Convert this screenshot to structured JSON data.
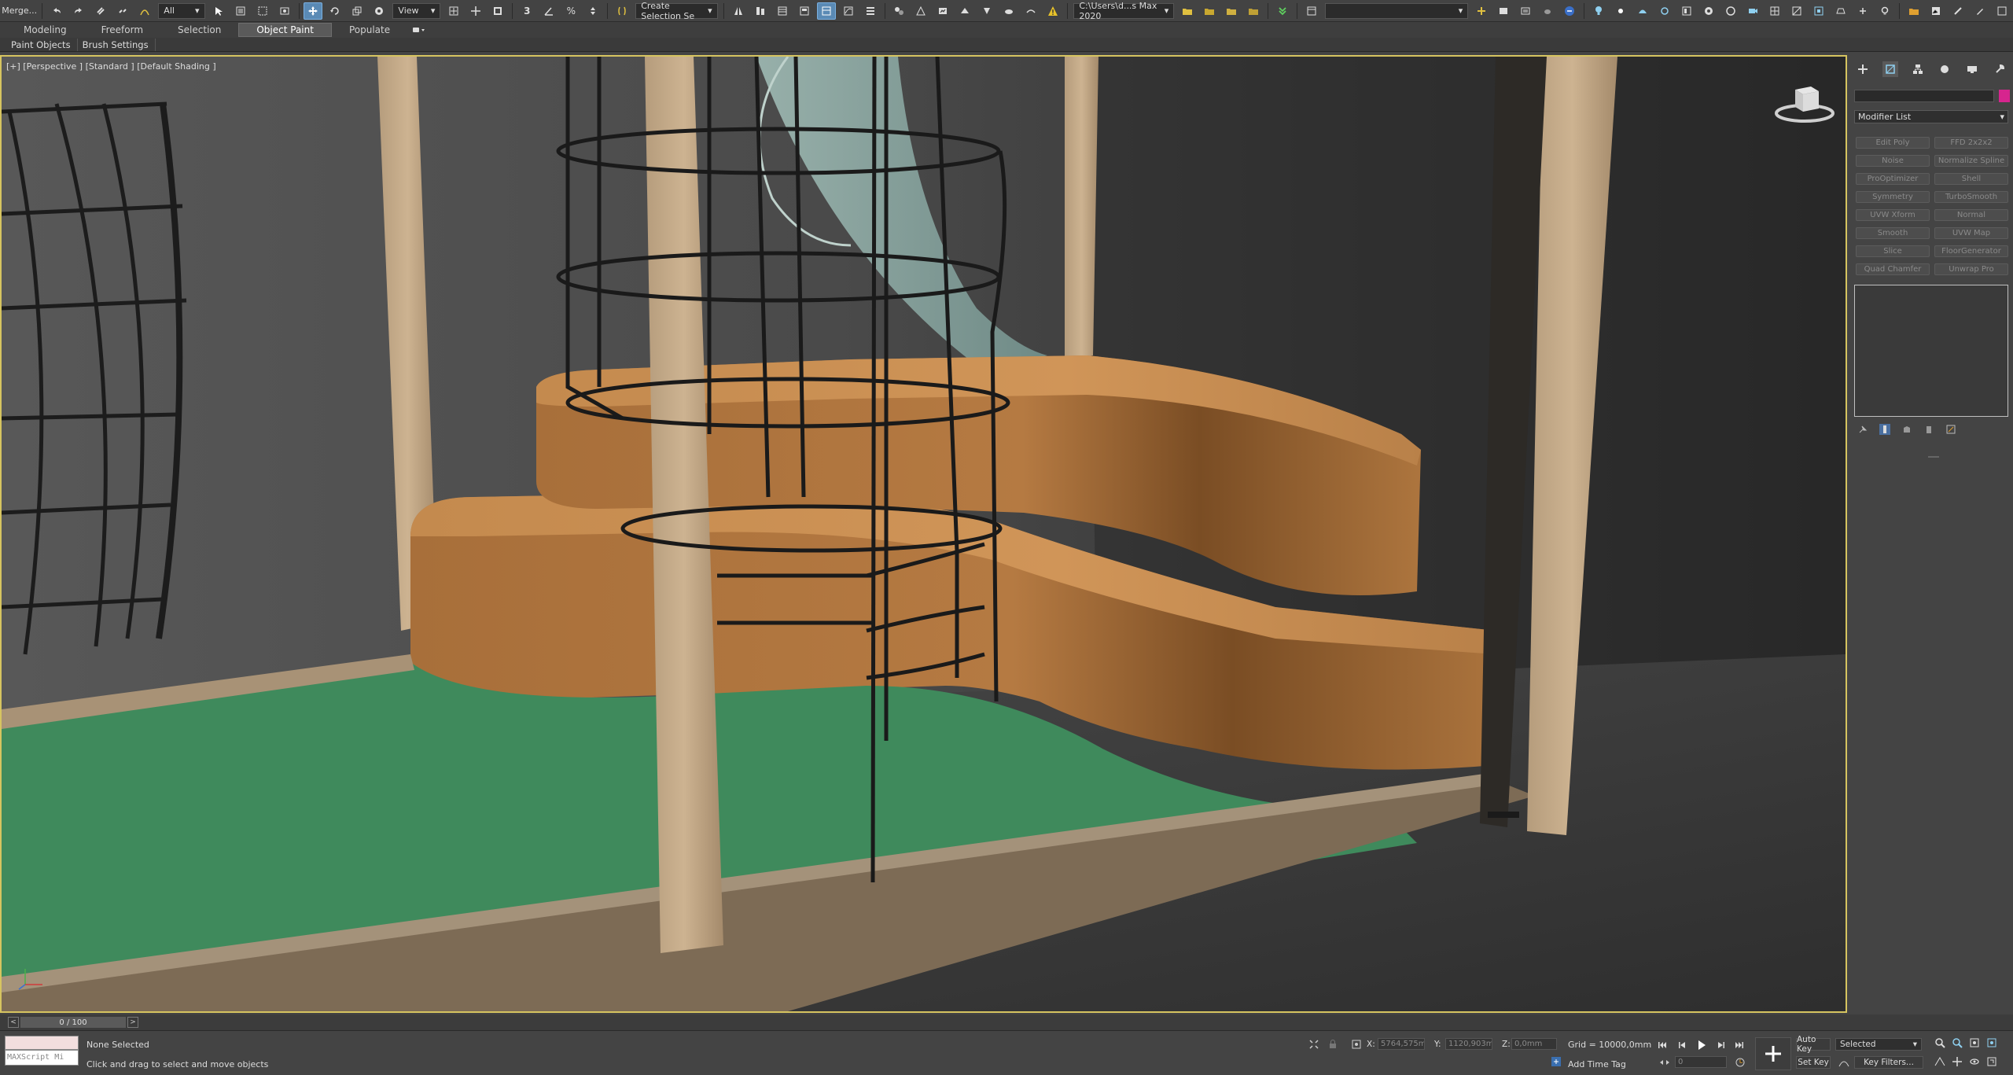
{
  "toolbar": {
    "merge_label": "Merge...",
    "filter_value": "All",
    "ref_coord_value": "View",
    "named_selection_placeholder": "Create Selection Se",
    "project_path": "C:\\Users\\d...s Max 2020"
  },
  "ribbon": {
    "tabs": [
      "Modeling",
      "Freeform",
      "Selection",
      "Object Paint",
      "Populate"
    ],
    "active_tab": "Object Paint",
    "sub_panels": [
      "Paint Objects",
      "Brush Settings"
    ]
  },
  "viewport": {
    "label": "[+] [Perspective ] [Standard ] [Default Shading ]"
  },
  "command_panel": {
    "modifier_list_label": "Modifier List",
    "modifier_buttons": [
      "Edit Poly",
      "FFD 2x2x2",
      "Noise",
      "Normalize Spline",
      "ProOptimizer",
      "Shell",
      "Symmetry",
      "TurboSmooth",
      "UVW Xform",
      "Normal",
      "Smooth",
      "UVW Map",
      "Slice",
      "FloorGenerator",
      "Quad Chamfer",
      "Unwrap Pro"
    ],
    "object_color": "#d6258e"
  },
  "timeline": {
    "frame_display": "0 / 100",
    "prev_label": "<",
    "next_label": ">"
  },
  "status": {
    "maxscript_text": "MAXScript Mi",
    "selection_text": "None Selected",
    "prompt_text": "Click and drag to select and move objects",
    "x_label": "X:",
    "x_value": "5764,575m",
    "y_label": "Y:",
    "y_value": "1120,903m",
    "z_label": "Z:",
    "z_value": "0,0mm",
    "grid_text": "Grid = 10000,0mm",
    "add_time_tag": "Add Time Tag",
    "auto_key": "Auto Key",
    "set_key": "Set Key",
    "selected_value": "Selected",
    "key_filters": "Key Filters...",
    "frame_value": "0"
  },
  "colors": {
    "viewport_border": "#d6c460",
    "wood": "#c8ad8a",
    "platform": "#b87a40",
    "floor_mat": "#3f8a5c",
    "slide": "#8fa8a2",
    "wireframe": "#1c1c1c"
  }
}
